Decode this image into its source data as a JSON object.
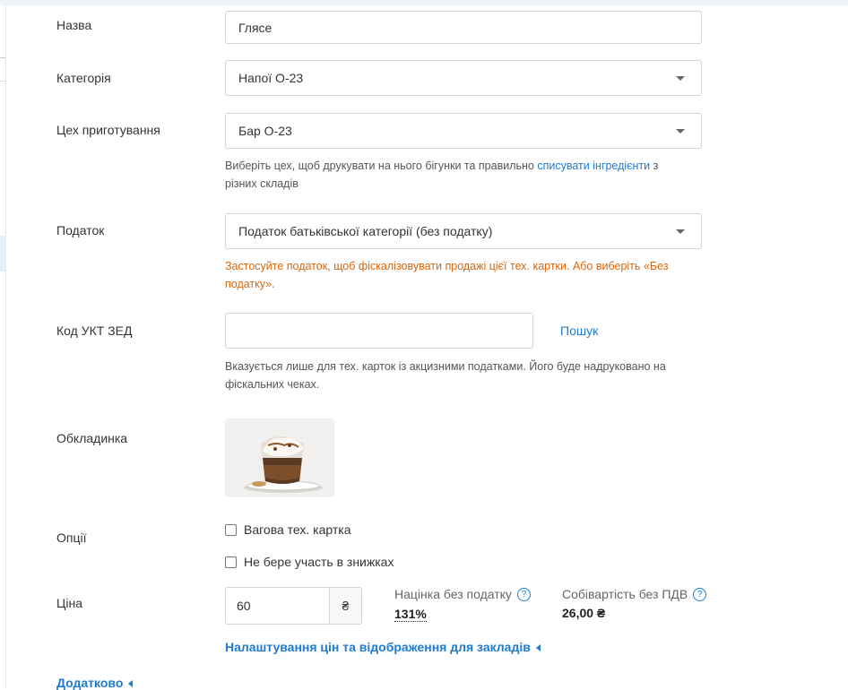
{
  "form": {
    "name": {
      "label": "Назва",
      "value": "Глясе"
    },
    "category": {
      "label": "Категорія",
      "value": "Напої О-23"
    },
    "workshop": {
      "label": "Цех приготування",
      "value": "Бар О-23",
      "hint_before": "Виберіть цех, щоб друкувати на нього бігунки та правильно ",
      "hint_link": "списувати інгредієнти",
      "hint_after": " з різних складів"
    },
    "tax": {
      "label": "Податок",
      "value": "Податок батьківської категорії (без податку)",
      "warning": "Застосуйте податок, щоб фіскалізовувати продажі цієї тех. картки. Або виберіть «Без податку»."
    },
    "ukt_zed": {
      "label": "Код УКТ ЗЕД",
      "value": "",
      "search_label": "Пошук",
      "hint": "Вказується лише для тех. карток із акцизними податками. Його буде надруковано на фіскальних чеках."
    },
    "cover": {
      "label": "Обкладинка"
    },
    "options": {
      "label": "Опції",
      "weighted": "Вагова тех. картка",
      "no_discounts": "Не бере участь в знижках"
    },
    "price": {
      "label": "Ціна",
      "value": "60",
      "currency": "₴",
      "markup_label": "Націнка без податку",
      "markup_value": "131%",
      "cost_label": "Собівартість без ПДВ",
      "cost_value": "26,00 ₴",
      "help_glyph": "?"
    },
    "price_settings_link": "Налаштування цін та відображення для закладів",
    "additional_link": "Додатково"
  }
}
